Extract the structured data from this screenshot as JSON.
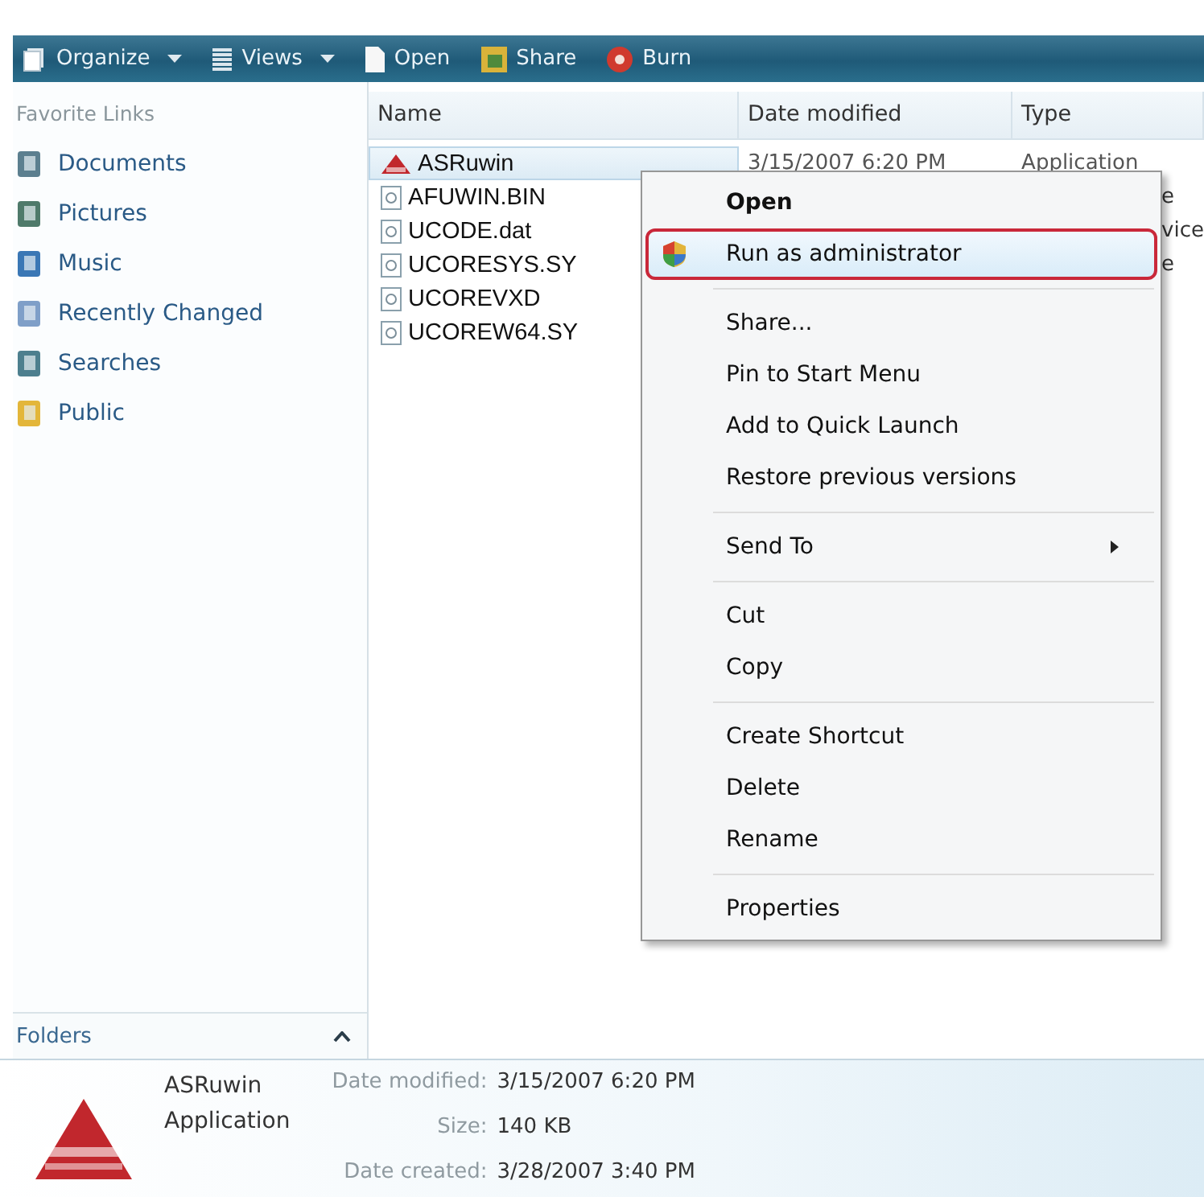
{
  "toolbar": [
    {
      "label": "Organize",
      "dropdown": true
    },
    {
      "label": "Views",
      "dropdown": true
    },
    {
      "label": "Open",
      "dropdown": false
    },
    {
      "label": "Share",
      "dropdown": false
    },
    {
      "label": "Burn",
      "dropdown": false
    }
  ],
  "sidebar": {
    "title": "Favorite Links",
    "items": [
      {
        "label": "Documents"
      },
      {
        "label": "Pictures"
      },
      {
        "label": "Music"
      },
      {
        "label": "Recently Changed"
      },
      {
        "label": "Searches"
      },
      {
        "label": "Public"
      }
    ],
    "folders": {
      "label": "Folders",
      "expanded": false
    }
  },
  "table": {
    "columns": [
      "Name",
      "Date modified",
      "Type"
    ],
    "rows": [
      {
        "name": "ASRuwin",
        "kind": "application",
        "selected": true,
        "date": "3/15/2007 6:20 PM",
        "type": "Application"
      },
      {
        "name": "AFUWIN.BIN",
        "kind": "file",
        "selected": false,
        "type_fragment": "e"
      },
      {
        "name": "UCODE.dat",
        "kind": "file",
        "selected": false,
        "type_fragment": "vice"
      },
      {
        "name": "UCORESYS.SY",
        "kind": "file",
        "selected": false,
        "type_fragment": "e"
      },
      {
        "name": "UCOREVXD",
        "kind": "file",
        "selected": false
      },
      {
        "name": "UCOREW64.SY",
        "kind": "file",
        "selected": false
      }
    ]
  },
  "context_menu": [
    {
      "kind": "item",
      "label": "Open",
      "bold": true,
      "selected": false
    },
    {
      "kind": "shield_item",
      "label": "Run as administrator",
      "selected": true
    },
    {
      "kind": "separator"
    },
    {
      "kind": "item",
      "label": "Share...",
      "selected": false
    },
    {
      "kind": "item",
      "label": "Pin to Start Menu",
      "selected": false
    },
    {
      "kind": "item",
      "label": "Add to Quick Launch",
      "selected": false
    },
    {
      "kind": "item",
      "label": "Restore previous versions",
      "selected": false
    },
    {
      "kind": "separator"
    },
    {
      "kind": "item",
      "label": "Send To",
      "submenu": true,
      "selected": false
    },
    {
      "kind": "separator"
    },
    {
      "kind": "item",
      "label": "Cut",
      "selected": false
    },
    {
      "kind": "item",
      "label": "Copy",
      "selected": false
    },
    {
      "kind": "separator"
    },
    {
      "kind": "item",
      "label": "Create Shortcut",
      "selected": false
    },
    {
      "kind": "item",
      "label": "Delete",
      "selected": false
    },
    {
      "kind": "item",
      "label": "Rename",
      "selected": false
    },
    {
      "kind": "separator"
    },
    {
      "kind": "item",
      "label": "Properties",
      "selected": false
    }
  ],
  "details": {
    "name": "ASRuwin",
    "kind": "Application",
    "fields": [
      {
        "label": "Date modified:",
        "value": "3/15/2007 6:20 PM"
      },
      {
        "label": "Size:",
        "value": "140 KB"
      },
      {
        "label": "Date created:",
        "value": "3/28/2007 3:40 PM"
      }
    ]
  }
}
